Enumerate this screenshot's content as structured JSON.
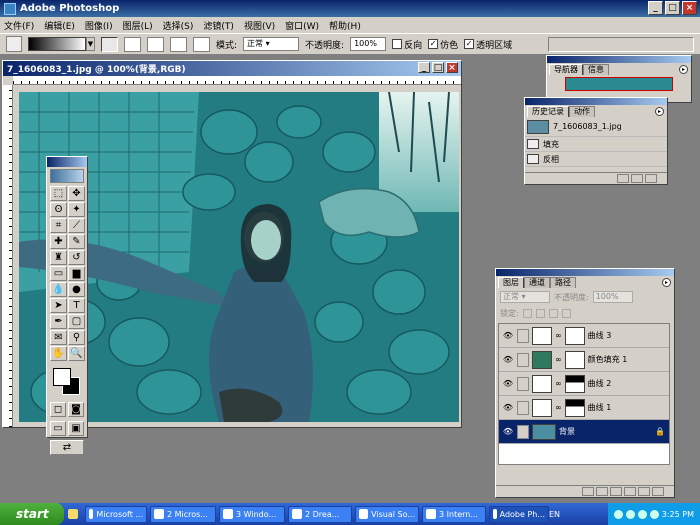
{
  "app": {
    "title": "Adobe Photoshop"
  },
  "menu": [
    "文件(F)",
    "编辑(E)",
    "图像(I)",
    "图层(L)",
    "选择(S)",
    "滤镜(T)",
    "视图(V)",
    "窗口(W)",
    "帮助(H)"
  ],
  "options": {
    "mode_label": "模式:",
    "mode_value": "正常",
    "opacity_label": "不透明度:",
    "opacity_value": "100%",
    "reverse_label": "反向",
    "dither_label": "仿色",
    "transparency_label": "透明区域",
    "reverse_checked": false,
    "dither_checked": true,
    "transparency_checked": true
  },
  "document": {
    "title": "7_1606083_1.jpg @ 100%(背景,RGB)"
  },
  "navigator": {
    "tabs": [
      "导航器",
      "信息"
    ]
  },
  "history": {
    "tabs": [
      "历史记录",
      "动作"
    ],
    "snapshot": "7_1606083_1.jpg",
    "items": [
      "填充",
      "反相"
    ]
  },
  "layers": {
    "tabs": [
      "图层",
      "通道",
      "路径"
    ],
    "blend_mode": "正常",
    "opacity_label": "不透明度:",
    "opacity_value": "100%",
    "lock_label": "锁定:",
    "rows": [
      {
        "name": "曲线 3",
        "kind": "adjust"
      },
      {
        "name": "颜色填充 1",
        "kind": "fill"
      },
      {
        "name": "曲线 2",
        "kind": "adjust"
      },
      {
        "name": "曲线 1",
        "kind": "adjust"
      },
      {
        "name": "背景",
        "kind": "background"
      }
    ]
  },
  "taskbar": {
    "start": "start",
    "tasks": [
      "Microsoft ...",
      "2 Micros...",
      "3 Windo...",
      "2 Drea...",
      "Visual So...",
      "3 Intern...",
      "Adobe Ph..."
    ],
    "lang": "EN",
    "clock": "3:25 PM"
  }
}
